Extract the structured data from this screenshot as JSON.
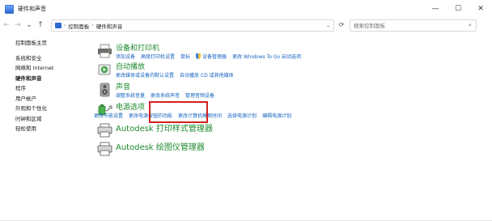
{
  "window": {
    "title": "硬件和声音",
    "minimize_glyph": "—",
    "maximize_glyph": "☐",
    "close_glyph": "✕"
  },
  "nav": {
    "back_glyph": "←",
    "forward_glyph": "→",
    "history_glyph": "⌄",
    "up_glyph": "↑",
    "refresh_glyph": "⟳"
  },
  "address_bar": {
    "separator": "›",
    "breadcrumbs": [
      "控制面板",
      "硬件和声音"
    ],
    "dropdown_glyph": "⌄"
  },
  "search": {
    "placeholder": "搜索控制面板",
    "icon_glyph": "⌕"
  },
  "sidebar": {
    "items": [
      {
        "label": "控制面板主页"
      },
      {
        "label": "系统和安全"
      },
      {
        "label": "网络和 Internet"
      },
      {
        "label": "硬件和声音"
      },
      {
        "label": "程序"
      },
      {
        "label": "用户帐户"
      },
      {
        "label": "外观和个性化"
      },
      {
        "label": "时钟和区域"
      },
      {
        "label": "轻松使用"
      }
    ]
  },
  "categories": [
    {
      "title": "设备和打印机",
      "icon": "printer-icon",
      "links": [
        "添加设备",
        "高级打印机设置",
        "鼠标",
        "设备管理器",
        "更改 Windows To Go 启动选项"
      ]
    },
    {
      "title": "自动播放",
      "icon": "autoplay-icon",
      "links": [
        "更改媒体或设备的默认设置",
        "自动播放 CD 或其他媒体"
      ]
    },
    {
      "title": "声音",
      "icon": "speaker-icon",
      "links": [
        "调整系统音量",
        "更改系统声音",
        "管理音频设备"
      ]
    },
    {
      "title": "电源选项",
      "icon": "power-icon",
      "links": [
        "更改节能设置",
        "更改电源按钮的功能",
        "更改计算机睡眠时间",
        "选择电源计划",
        "编辑电源计划"
      ]
    },
    {
      "title": "Autodesk 打印样式管理器",
      "icon": "autodesk-printer-icon",
      "links": []
    },
    {
      "title": "Autodesk 绘图仪管理器",
      "icon": "autodesk-plotter-icon",
      "links": []
    }
  ],
  "colors": {
    "category_title": "#1e8a2e",
    "link": "#1563bf",
    "highlight_box": "#d32020"
  }
}
